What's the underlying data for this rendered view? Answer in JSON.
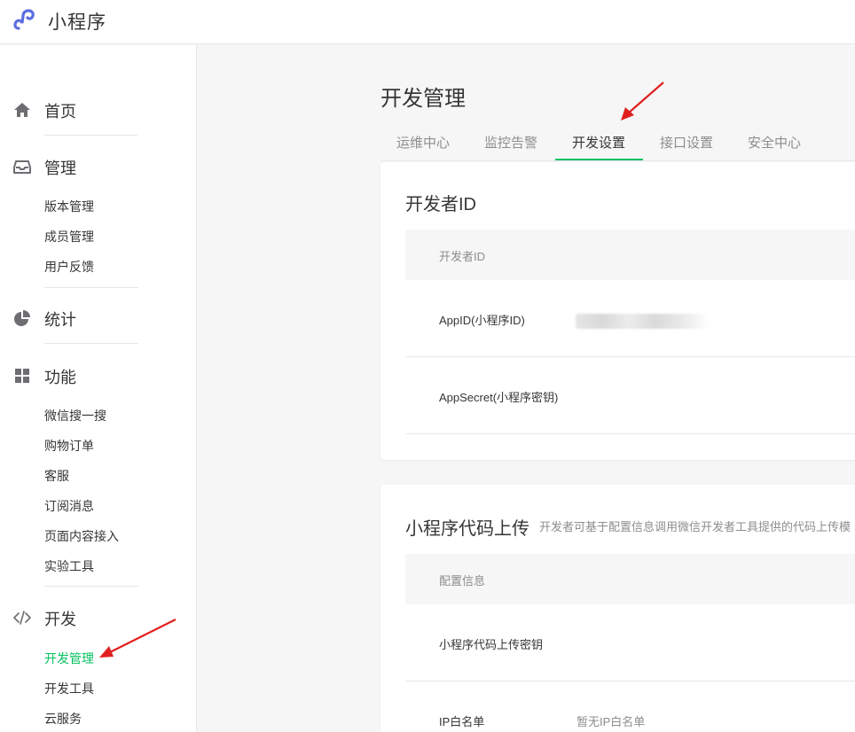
{
  "app": {
    "title": "小程序",
    "accent": "#07c160",
    "logo_color": "#5b6ee1"
  },
  "sidebar": {
    "home": "首页",
    "manage": {
      "label": "管理",
      "items": [
        "版本管理",
        "成员管理",
        "用户反馈"
      ]
    },
    "stats": "统计",
    "features": {
      "label": "功能",
      "items": [
        "微信搜一搜",
        "购物订单",
        "客服",
        "订阅消息",
        "页面内容接入",
        "实验工具"
      ]
    },
    "dev": {
      "label": "开发",
      "items": [
        "开发管理",
        "开发工具",
        "云服务"
      ]
    }
  },
  "main": {
    "title": "开发管理",
    "tabs": [
      "运维中心",
      "监控告警",
      "开发设置",
      "接口设置",
      "安全中心"
    ],
    "active_tab": "开发设置"
  },
  "dev_id_card": {
    "title": "开发者ID",
    "table_header": "开发者ID",
    "rows": [
      {
        "key": "AppID(小程序ID)",
        "value": ""
      },
      {
        "key": "AppSecret(小程序密钥)",
        "value": ""
      }
    ]
  },
  "upload_card": {
    "title": "小程序代码上传",
    "desc": "开发者可基于配置信息调用微信开发者工具提供的代码上传模",
    "table_header": "配置信息",
    "rows": [
      {
        "key": "小程序代码上传密钥",
        "value": ""
      },
      {
        "key": "IP白名单",
        "value": "暂无IP白名单"
      }
    ]
  },
  "annotation_color": "#e02020"
}
